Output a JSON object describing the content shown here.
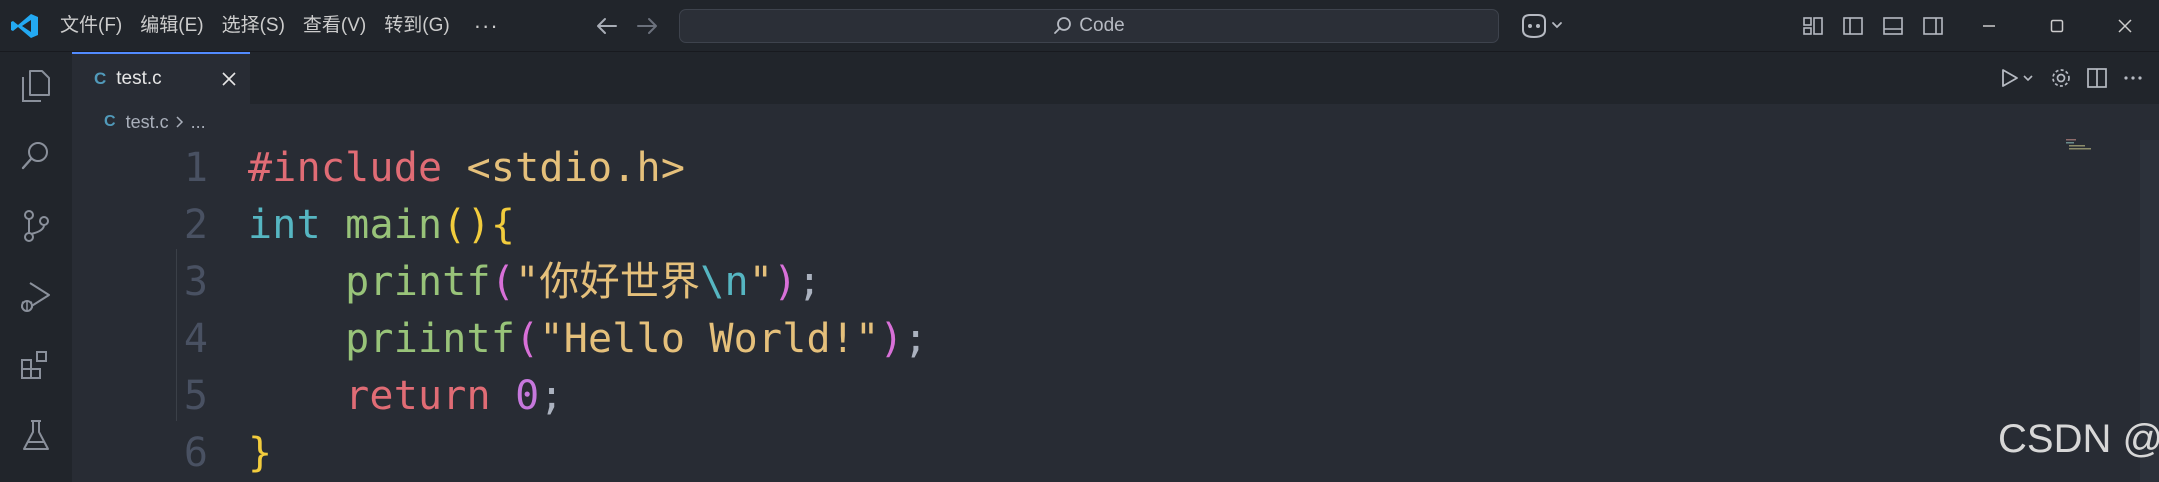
{
  "menu": {
    "items": [
      "文件(F)",
      "编辑(E)",
      "选择(S)",
      "查看(V)",
      "转到(G)"
    ],
    "more": "···"
  },
  "command_center": {
    "label": "Code"
  },
  "tab": {
    "lang_icon": "C",
    "label": "test.c"
  },
  "breadcrumb": {
    "lang_icon": "C",
    "file": "test.c",
    "rest": "..."
  },
  "editor": {
    "lines": [
      {
        "number": "1",
        "tokens": [
          {
            "t": "#include",
            "c": "tk-prep"
          },
          {
            "t": " ",
            "c": "tk-punc"
          },
          {
            "t": "<stdio.h>",
            "c": "tk-header"
          }
        ]
      },
      {
        "number": "2",
        "tokens": [
          {
            "t": "int",
            "c": "tk-type"
          },
          {
            "t": " ",
            "c": "tk-punc"
          },
          {
            "t": "main",
            "c": "tk-fn"
          },
          {
            "t": "()",
            "c": "tk-paren1"
          },
          {
            "t": "{",
            "c": "tk-paren1"
          }
        ]
      },
      {
        "number": "3",
        "tokens": [
          {
            "t": "    ",
            "c": "tk-punc"
          },
          {
            "t": "printf",
            "c": "tk-fn"
          },
          {
            "t": "(",
            "c": "tk-paren2"
          },
          {
            "t": "\"你好世界",
            "c": "tk-str"
          },
          {
            "t": "\\n",
            "c": "tk-esc"
          },
          {
            "t": "\"",
            "c": "tk-str"
          },
          {
            "t": ")",
            "c": "tk-paren2"
          },
          {
            "t": ";",
            "c": "tk-punc"
          }
        ]
      },
      {
        "number": "4",
        "tokens": [
          {
            "t": "    ",
            "c": "tk-punc"
          },
          {
            "t": "priintf",
            "c": "tk-fn"
          },
          {
            "t": "(",
            "c": "tk-paren2"
          },
          {
            "t": "\"Hello World!\"",
            "c": "tk-str"
          },
          {
            "t": ")",
            "c": "tk-paren2"
          },
          {
            "t": ";",
            "c": "tk-punc"
          }
        ]
      },
      {
        "number": "5",
        "tokens": [
          {
            "t": "    ",
            "c": "tk-punc"
          },
          {
            "t": "return",
            "c": "tk-kw"
          },
          {
            "t": " ",
            "c": "tk-punc"
          },
          {
            "t": "0",
            "c": "tk-num"
          },
          {
            "t": ";",
            "c": "tk-punc"
          }
        ]
      },
      {
        "number": "6",
        "tokens": [
          {
            "t": "}",
            "c": "tk-paren1"
          }
        ]
      }
    ]
  },
  "watermark": "CSDN @",
  "colors": {
    "accent": "#528bff",
    "logo": "#23a9f2"
  },
  "icons": {
    "activity_bar": [
      "explorer-icon",
      "search-icon",
      "source-control-icon",
      "run-debug-icon",
      "extensions-icon",
      "testing-icon"
    ],
    "window_controls": [
      "minimize-icon",
      "maximize-icon",
      "close-icon"
    ]
  }
}
